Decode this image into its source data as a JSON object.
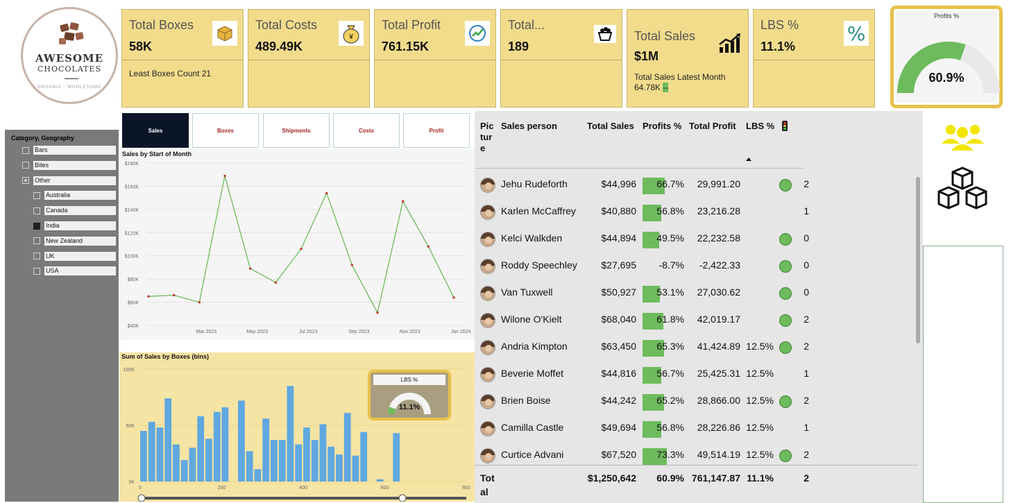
{
  "logo": {
    "line1": "AWESOME",
    "line2": "CHOCOLATES",
    "tagline": "ORGANIC · WHOLESOME"
  },
  "cards": [
    {
      "title": "Total Boxes",
      "value": "58K",
      "sub": "Least Boxes Count 21",
      "icon": "package-icon"
    },
    {
      "title": "Total Costs",
      "value": "489.49K",
      "sub": "",
      "icon": "money-bag-icon"
    },
    {
      "title": "Total Profit",
      "value": "761.15K",
      "sub": "",
      "icon": "growth-chart-icon"
    },
    {
      "title": "Total...",
      "value": "189",
      "sub": "",
      "icon": "gift-basket-icon"
    },
    {
      "title": "Total Sales",
      "value": "$1M",
      "sub": "Total Sales Latest Month",
      "sub2": "64.78K",
      "sub2_flag": "--",
      "icon": "bar-trend-icon"
    },
    {
      "title": "LBS %",
      "value": "11.1%",
      "sub": "",
      "icon": "percent-icon"
    }
  ],
  "profits_gauge": {
    "title": "Profits %",
    "value_label": "60.9%",
    "value": 0.609,
    "color": "#6dbb5c"
  },
  "slicer": {
    "header": "Category, Geography",
    "items": [
      {
        "label": "Bars",
        "level": 0,
        "state": "off"
      },
      {
        "label": "Bites",
        "level": 0,
        "state": "off"
      },
      {
        "label": "Other",
        "level": 0,
        "state": "partial"
      },
      {
        "label": "Australia",
        "level": 1,
        "state": "off"
      },
      {
        "label": "Canada",
        "level": 1,
        "state": "off"
      },
      {
        "label": "India",
        "level": 1,
        "state": "on"
      },
      {
        "label": "New Zealand",
        "level": 1,
        "state": "off"
      },
      {
        "label": "UK",
        "level": 1,
        "state": "off"
      },
      {
        "label": "USA",
        "level": 1,
        "state": "off"
      }
    ]
  },
  "tabs": [
    {
      "label": "Sales",
      "active": true
    },
    {
      "label": "Boxes",
      "active": false
    },
    {
      "label": "Shipments",
      "active": false
    },
    {
      "label": "Costs",
      "active": false
    },
    {
      "label": "Profit",
      "active": false
    }
  ],
  "chart_data": [
    {
      "type": "line",
      "title": "Sales by Start of Month",
      "x_tick_labels": [
        "Mar 2023",
        "May 2023",
        "Jul 2023",
        "Sep 2023",
        "Nov 2023",
        "Jan 2024"
      ],
      "y_tick_labels": [
        "$40K",
        "$60K",
        "$80K",
        "$100K",
        "$120K",
        "$140K",
        "$160K",
        "$180K"
      ],
      "ylim": [
        40000,
        180000
      ],
      "x": [
        "Jan 2023",
        "Feb 2023",
        "Mar 2023",
        "Apr 2023",
        "May 2023",
        "Jun 2023",
        "Jul 2023",
        "Aug 2023",
        "Sep 2023",
        "Oct 2023",
        "Nov 2023",
        "Dec 2023",
        "Jan 2024",
        "Feb 2024"
      ],
      "values": [
        65000,
        66000,
        60000,
        169000,
        89000,
        77000,
        106000,
        154000,
        92000,
        51000,
        147000,
        108000,
        64000
      ],
      "color": "#6dbb5c",
      "marker_color": "#c0392b"
    },
    {
      "type": "bar",
      "title": "Sum of Sales by Boxes (bins)",
      "x_tick_labels": [
        "0",
        "200",
        "400",
        "600",
        "800"
      ],
      "y_tick_labels": [
        "0K",
        "50K",
        "100K"
      ],
      "xlim": [
        0,
        800
      ],
      "ylim": [
        0,
        100000
      ],
      "bin_width": 20,
      "bins_start": [
        0,
        20,
        40,
        60,
        80,
        100,
        120,
        140,
        160,
        180,
        200,
        220,
        240,
        260,
        280,
        300,
        320,
        340,
        360,
        380,
        400,
        420,
        440,
        460,
        480,
        500,
        520,
        540,
        560,
        580,
        600,
        620,
        640,
        660,
        680,
        700,
        720,
        740,
        760,
        780
      ],
      "values": [
        45000,
        53000,
        48000,
        74000,
        33000,
        19000,
        30000,
        58000,
        38000,
        62000,
        66000,
        0,
        72000,
        27000,
        11000,
        56000,
        37000,
        37000,
        85000,
        33000,
        48000,
        37000,
        51000,
        31000,
        24000,
        61000,
        23000,
        44000,
        0,
        2000,
        0,
        43000,
        0,
        0,
        0,
        0,
        0,
        0,
        0,
        0
      ],
      "color": "#5fa8e0"
    }
  ],
  "lbs_gauge": {
    "title": "LBS %",
    "value_label": "11.1%",
    "value": 0.111,
    "color": "#6dbb5c"
  },
  "table": {
    "headers": {
      "picture": "Pic tur e",
      "person": "Sales person",
      "sales": "Total Sales",
      "profit_pct": "Profits %",
      "profit": "Total Profit",
      "lbs": "LBS %",
      "icon": "traffic-light-icon"
    },
    "rows": [
      {
        "name": "Jehu Rudeforth",
        "sales": "$44,996",
        "pct": "66.7%",
        "pct_value": 0.667,
        "profit": "29,991.20",
        "lbs": "",
        "dot": true,
        "count": "2"
      },
      {
        "name": "Karlen McCaffrey",
        "sales": "$40,880",
        "pct": "56.8%",
        "pct_value": 0.568,
        "profit": "23,216.28",
        "lbs": "",
        "dot": false,
        "count": "1"
      },
      {
        "name": "Kelci Walkden",
        "sales": "$44,894",
        "pct": "49.5%",
        "pct_value": 0.495,
        "profit": "22,232.58",
        "lbs": "",
        "dot": true,
        "count": "0"
      },
      {
        "name": "Roddy Speechley",
        "sales": "$27,695",
        "pct": "-8.7%",
        "pct_value": -0.087,
        "profit": "-2,422.33",
        "lbs": "",
        "dot": true,
        "count": "0"
      },
      {
        "name": "Van Tuxwell",
        "sales": "$50,927",
        "pct": "53.1%",
        "pct_value": 0.531,
        "profit": "27,030.62",
        "lbs": "",
        "dot": true,
        "count": "0"
      },
      {
        "name": "Wilone O'Kielt",
        "sales": "$68,040",
        "pct": "61.8%",
        "pct_value": 0.618,
        "profit": "42,019.17",
        "lbs": "",
        "dot": true,
        "count": "2"
      },
      {
        "name": "Andria Kimpton",
        "sales": "$63,450",
        "pct": "65.3%",
        "pct_value": 0.653,
        "profit": "41,424.89",
        "lbs": "12.5%",
        "dot": true,
        "count": "2"
      },
      {
        "name": "Beverie Moffet",
        "sales": "$44,816",
        "pct": "56.7%",
        "pct_value": 0.567,
        "profit": "25,425.31",
        "lbs": "12.5%",
        "dot": false,
        "count": "1"
      },
      {
        "name": "Brien Boise",
        "sales": "$44,242",
        "pct": "65.2%",
        "pct_value": 0.652,
        "profit": "28,866.00",
        "lbs": "12.5%",
        "dot": true,
        "count": "2"
      },
      {
        "name": "Camilla Castle",
        "sales": "$49,694",
        "pct": "56.8%",
        "pct_value": 0.568,
        "profit": "28,226.86",
        "lbs": "12.5%",
        "dot": false,
        "count": "1"
      },
      {
        "name": "Curtice Advani",
        "sales": "$67,520",
        "pct": "73.3%",
        "pct_value": 0.733,
        "profit": "49,514.19",
        "lbs": "12.5%",
        "dot": true,
        "count": "2"
      }
    ],
    "total": {
      "label": "Tot al",
      "sales": "$1,250,642",
      "pct": "60.9%",
      "profit": "761,147.87",
      "lbs": "11.1%",
      "count": "2"
    }
  },
  "side_icons": [
    "people-icon",
    "boxes-icon"
  ]
}
